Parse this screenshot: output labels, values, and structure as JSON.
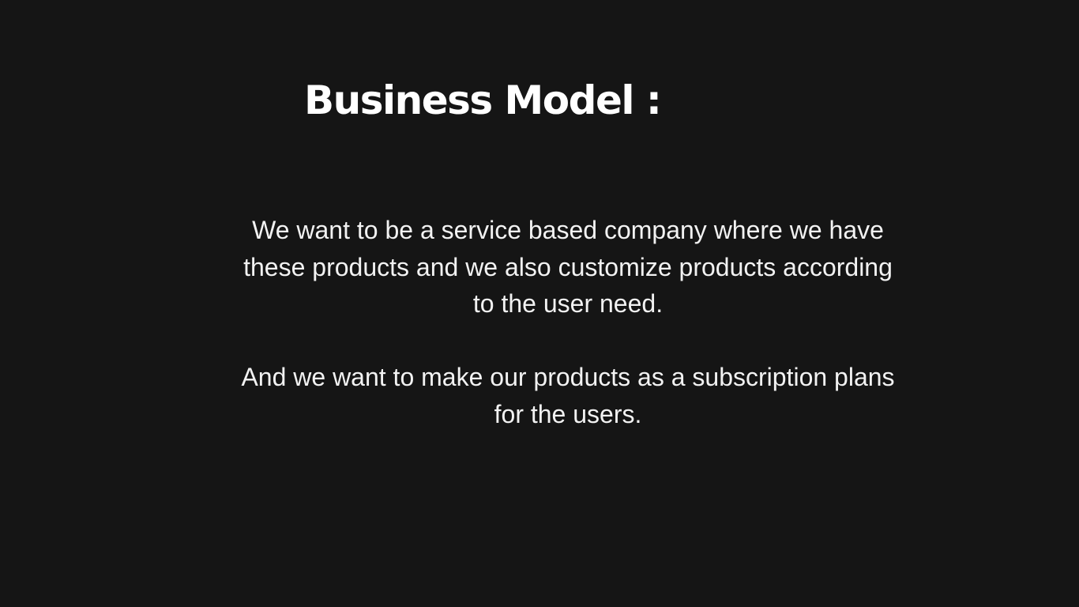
{
  "slide": {
    "title": "Business Model :",
    "paragraphs": [
      "We want to be a service based company where we have these products and we also customize products according to the user need.",
      "And we want to make our products as a subscription plans for the users."
    ]
  },
  "colors": {
    "background": "#151515",
    "title": "#ffffff",
    "body_text": "#f2f2f2"
  }
}
